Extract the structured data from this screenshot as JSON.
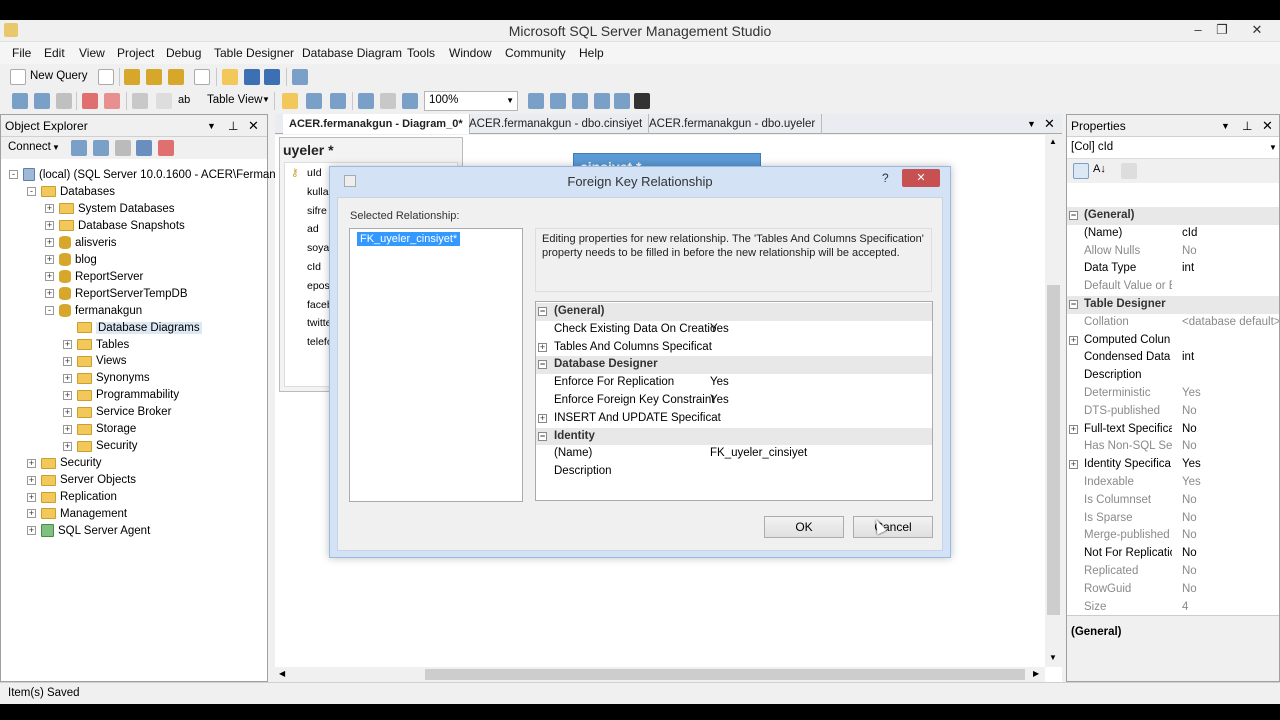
{
  "app": {
    "title": "Microsoft SQL Server Management Studio"
  },
  "menu": [
    "File",
    "Edit",
    "View",
    "Project",
    "Debug",
    "Table Designer",
    "Database Diagram",
    "Tools",
    "Window",
    "Community",
    "Help"
  ],
  "toolbar1": {
    "new_query": "New Query"
  },
  "toolbar2": {
    "table_view": "Table View",
    "zoom": "100%"
  },
  "object_explorer": {
    "title": "Object Explorer",
    "connect": "Connect",
    "tree": [
      {
        "label": "(local) (SQL Server 10.0.1600 - ACER\\Ferman)",
        "depth": 0,
        "exp": "-",
        "icon": "server-icon"
      },
      {
        "label": "Databases",
        "depth": 1,
        "exp": "-",
        "icon": "folder-icon"
      },
      {
        "label": "System Databases",
        "depth": 2,
        "exp": "+",
        "icon": "folder-icon"
      },
      {
        "label": "Database Snapshots",
        "depth": 2,
        "exp": "+",
        "icon": "folder-icon"
      },
      {
        "label": "alisveris",
        "depth": 2,
        "exp": "+",
        "icon": "database-icon"
      },
      {
        "label": "blog",
        "depth": 2,
        "exp": "+",
        "icon": "database-icon"
      },
      {
        "label": "ReportServer",
        "depth": 2,
        "exp": "+",
        "icon": "database-icon"
      },
      {
        "label": "ReportServerTempDB",
        "depth": 2,
        "exp": "+",
        "icon": "database-icon"
      },
      {
        "label": "fermanakgun",
        "depth": 2,
        "exp": "-",
        "icon": "database-icon"
      },
      {
        "label": "Database Diagrams",
        "depth": 3,
        "exp": "",
        "icon": "folder-icon",
        "selected": true
      },
      {
        "label": "Tables",
        "depth": 3,
        "exp": "+",
        "icon": "folder-icon"
      },
      {
        "label": "Views",
        "depth": 3,
        "exp": "+",
        "icon": "folder-icon"
      },
      {
        "label": "Synonyms",
        "depth": 3,
        "exp": "+",
        "icon": "folder-icon"
      },
      {
        "label": "Programmability",
        "depth": 3,
        "exp": "+",
        "icon": "folder-icon"
      },
      {
        "label": "Service Broker",
        "depth": 3,
        "exp": "+",
        "icon": "folder-icon"
      },
      {
        "label": "Storage",
        "depth": 3,
        "exp": "+",
        "icon": "folder-icon"
      },
      {
        "label": "Security",
        "depth": 3,
        "exp": "+",
        "icon": "folder-icon"
      },
      {
        "label": "Security",
        "depth": 1,
        "exp": "+",
        "icon": "folder-icon"
      },
      {
        "label": "Server Objects",
        "depth": 1,
        "exp": "+",
        "icon": "folder-icon"
      },
      {
        "label": "Replication",
        "depth": 1,
        "exp": "+",
        "icon": "folder-icon"
      },
      {
        "label": "Management",
        "depth": 1,
        "exp": "+",
        "icon": "folder-icon"
      },
      {
        "label": "SQL Server Agent",
        "depth": 1,
        "exp": "+",
        "icon": "agent-icon"
      }
    ]
  },
  "tabs": [
    {
      "label": "ACER.fermanakgun - Diagram_0*",
      "active": true
    },
    {
      "label": "ACER.fermanakgun - dbo.cinsiyet",
      "active": false
    },
    {
      "label": "ACER.fermanakgun - dbo.uyeler",
      "active": false
    }
  ],
  "diagram": {
    "uyeler": {
      "title": "uyeler *",
      "columns": [
        "uId",
        "kullan",
        "sifre",
        "ad",
        "soyad",
        "cId",
        "eposta",
        "faceb",
        "twitte",
        "telefo"
      ]
    },
    "cinsiyet": {
      "title": "cinsiyet *"
    }
  },
  "dialog": {
    "title": "Foreign Key Relationship",
    "help": "?",
    "close": "✕",
    "selected_label": "Selected Relationship:",
    "selected_item": "FK_uyeler_cinsiyet*",
    "info": "Editing properties for new relationship.  The 'Tables And Columns Specification' property needs to be filled in before the new relationship will be accepted.",
    "grid": [
      {
        "type": "cat",
        "label": "(General)"
      },
      {
        "type": "row",
        "key": "Check Existing Data On Creatio",
        "value": "Yes"
      },
      {
        "type": "row",
        "key": "Tables And Columns Specificat",
        "value": "",
        "exp": "+"
      },
      {
        "type": "cat",
        "label": "Database Designer"
      },
      {
        "type": "row",
        "key": "Enforce For Replication",
        "value": "Yes"
      },
      {
        "type": "row",
        "key": "Enforce Foreign Key Constraint",
        "value": "Yes"
      },
      {
        "type": "row",
        "key": "INSERT And UPDATE Specificat",
        "value": "",
        "exp": "+"
      },
      {
        "type": "cat",
        "label": "Identity"
      },
      {
        "type": "row",
        "key": "(Name)",
        "value": "FK_uyeler_cinsiyet"
      },
      {
        "type": "row",
        "key": "Description",
        "value": ""
      }
    ],
    "ok": "OK",
    "cancel": "Cancel"
  },
  "properties": {
    "title": "Properties",
    "object": "[Col] cId",
    "rows": [
      {
        "type": "cat",
        "label": "(General)"
      },
      {
        "k": "(Name)",
        "v": "cId",
        "gray": false
      },
      {
        "k": "Allow Nulls",
        "v": "No",
        "gray": true
      },
      {
        "k": "Data Type",
        "v": "int",
        "gray": false
      },
      {
        "k": "Default Value or B",
        "v": "",
        "gray": true
      },
      {
        "type": "cat",
        "label": "Table Designer"
      },
      {
        "k": "Collation",
        "v": "<database default>",
        "gray": true
      },
      {
        "k": "Computed Colun",
        "v": "",
        "gray": false,
        "exp": "+"
      },
      {
        "k": "Condensed Data",
        "v": "int",
        "gray": false
      },
      {
        "k": "Description",
        "v": "",
        "gray": false
      },
      {
        "k": "Deterministic",
        "v": "Yes",
        "gray": true
      },
      {
        "k": "DTS-published",
        "v": "No",
        "gray": true
      },
      {
        "k": "Full-text Specifica",
        "v": "No",
        "gray": false,
        "exp": "+"
      },
      {
        "k": "Has Non-SQL Ser",
        "v": "No",
        "gray": true
      },
      {
        "k": "Identity Specifica",
        "v": "Yes",
        "gray": false,
        "exp": "+"
      },
      {
        "k": "Indexable",
        "v": "Yes",
        "gray": true
      },
      {
        "k": "Is Columnset",
        "v": "No",
        "gray": true
      },
      {
        "k": "Is Sparse",
        "v": "No",
        "gray": true
      },
      {
        "k": "Merge-published",
        "v": "No",
        "gray": true
      },
      {
        "k": "Not For Replicatic",
        "v": "No",
        "gray": false
      },
      {
        "k": "Replicated",
        "v": "No",
        "gray": true
      },
      {
        "k": "RowGuid",
        "v": "No",
        "gray": true
      },
      {
        "k": "Size",
        "v": "4",
        "gray": true
      }
    ],
    "footer": "(General)"
  },
  "status": {
    "text": "Item(s) Saved"
  }
}
